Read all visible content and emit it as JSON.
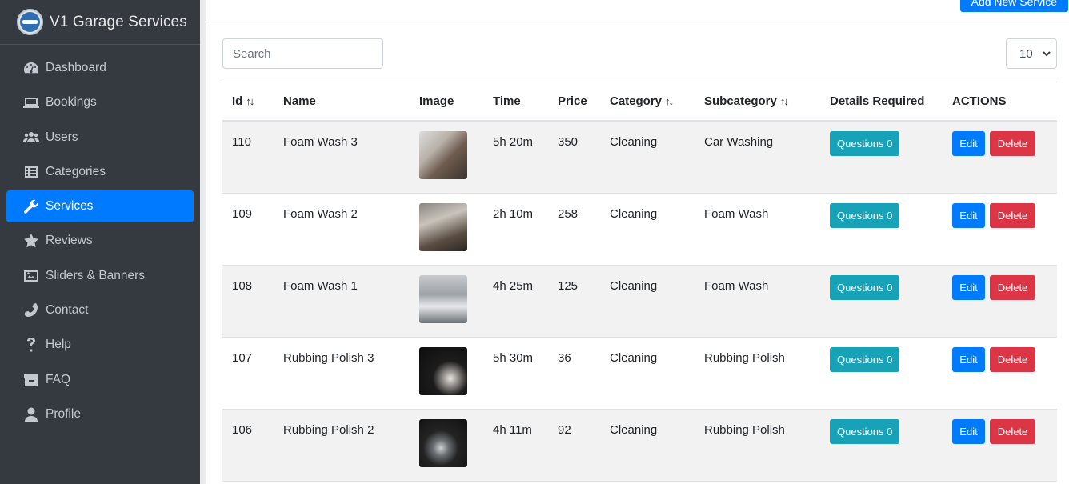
{
  "brand": {
    "title": "V1 Garage Services"
  },
  "sidebar": {
    "items": [
      {
        "label": "Dashboard",
        "icon": "dashboard-icon",
        "active": false
      },
      {
        "label": "Bookings",
        "icon": "bookings-icon",
        "active": false
      },
      {
        "label": "Users",
        "icon": "users-icon",
        "active": false
      },
      {
        "label": "Categories",
        "icon": "categories-icon",
        "active": false
      },
      {
        "label": "Services",
        "icon": "wrench-icon",
        "active": true
      },
      {
        "label": "Reviews",
        "icon": "star-icon",
        "active": false
      },
      {
        "label": "Sliders & Banners",
        "icon": "image-icon",
        "active": false
      },
      {
        "label": "Contact",
        "icon": "phone-icon",
        "active": false
      },
      {
        "label": "Help",
        "icon": "question-icon",
        "active": false
      },
      {
        "label": "FAQ",
        "icon": "box-icon",
        "active": false
      },
      {
        "label": "Profile",
        "icon": "user-icon",
        "active": false
      }
    ]
  },
  "toolbar": {
    "add_label": "Add New Service"
  },
  "search": {
    "placeholder": "Search"
  },
  "pagesize": {
    "value": "10"
  },
  "table": {
    "headers": {
      "id": "Id",
      "name": "Name",
      "image": "Image",
      "time": "Time",
      "price": "Price",
      "category": "Category",
      "subcategory": "Subcategory",
      "details": "Details Required",
      "actions": "ACTIONS"
    },
    "rows": [
      {
        "id": "110",
        "name": "Foam Wash 3",
        "time": "5h 20m",
        "price": "350",
        "category": "Cleaning",
        "subcategory": "Car Washing",
        "questions": "Questions 0",
        "edit": "Edit",
        "delete": "Delete"
      },
      {
        "id": "109",
        "name": "Foam Wash 2",
        "time": "2h 10m",
        "price": "258",
        "category": "Cleaning",
        "subcategory": "Foam Wash",
        "questions": "Questions 0",
        "edit": "Edit",
        "delete": "Delete"
      },
      {
        "id": "108",
        "name": "Foam Wash 1",
        "time": "4h 25m",
        "price": "125",
        "category": "Cleaning",
        "subcategory": "Foam Wash",
        "questions": "Questions 0",
        "edit": "Edit",
        "delete": "Delete"
      },
      {
        "id": "107",
        "name": "Rubbing Polish 3",
        "time": "5h 30m",
        "price": "36",
        "category": "Cleaning",
        "subcategory": "Rubbing Polish",
        "questions": "Questions 0",
        "edit": "Edit",
        "delete": "Delete"
      },
      {
        "id": "106",
        "name": "Rubbing Polish 2",
        "time": "4h 11m",
        "price": "92",
        "category": "Cleaning",
        "subcategory": "Rubbing Polish",
        "questions": "Questions 0",
        "edit": "Edit",
        "delete": "Delete"
      }
    ]
  },
  "colors": {
    "sidebar": "#343a40",
    "primary": "#007bff",
    "info": "#17a2b8",
    "danger": "#dc3545"
  }
}
